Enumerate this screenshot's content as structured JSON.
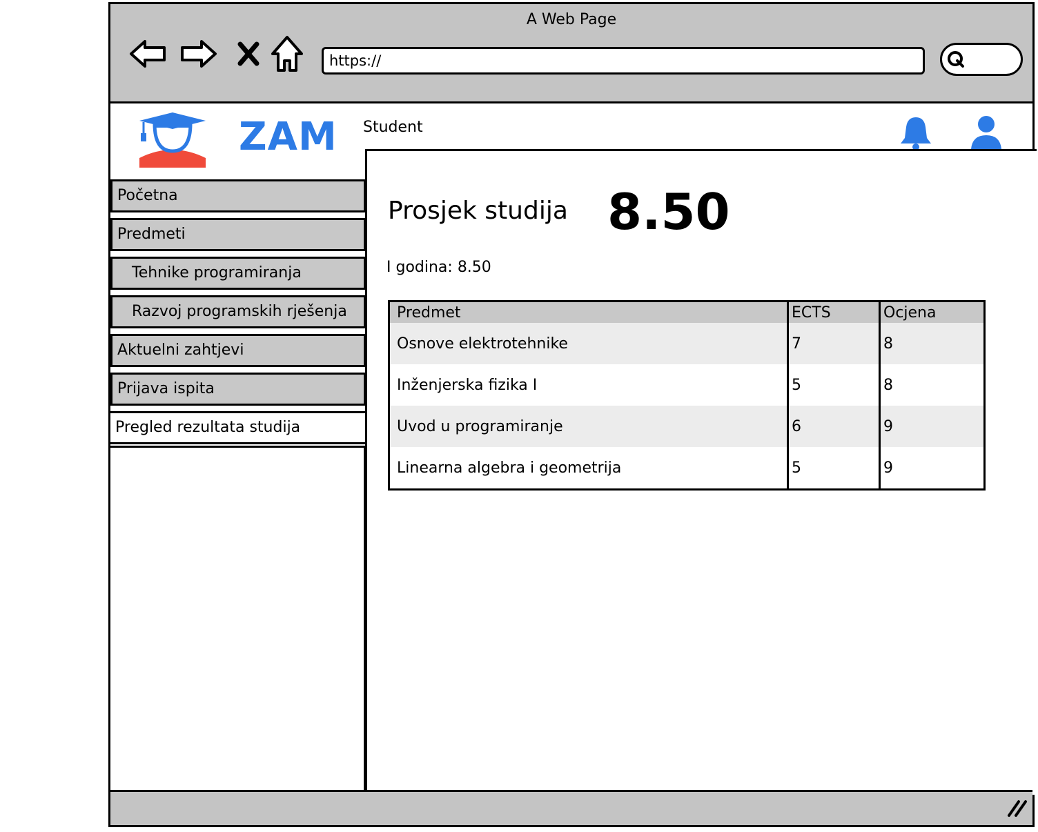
{
  "browser": {
    "title": "A Web Page",
    "url": "https://",
    "icons": [
      "back-arrow-icon",
      "forward-arrow-icon",
      "close-x-icon",
      "home-icon",
      "search-icon"
    ]
  },
  "app": {
    "brand": "ZAM",
    "role": "Student",
    "brand_color": "#2d7be5",
    "logo_accent": "#f04a3a"
  },
  "sidebar": {
    "items": [
      {
        "label": "Početna"
      },
      {
        "label": "Predmeti"
      },
      {
        "label": "Tehnike programiranja"
      },
      {
        "label": "Razvoj programskih rješenja"
      },
      {
        "label": "Aktuelni zahtjevi"
      },
      {
        "label": "Prijava ispita"
      },
      {
        "label": "Pregled rezultata studija"
      }
    ]
  },
  "main": {
    "average_label": "Prosjek studija",
    "average_value": "8.50",
    "year_summary": "I godina: 8.50",
    "table": {
      "headers": [
        "Predmet",
        "ECTS",
        "Ocjena"
      ],
      "rows": [
        [
          "Osnove elektrotehnike",
          "7",
          "8"
        ],
        [
          "Inženjerska fizika I",
          "5",
          "8"
        ],
        [
          "Uvod u programiranje",
          "6",
          "9"
        ],
        [
          "Linearna algebra i geometrija",
          "5",
          "9"
        ]
      ]
    }
  }
}
